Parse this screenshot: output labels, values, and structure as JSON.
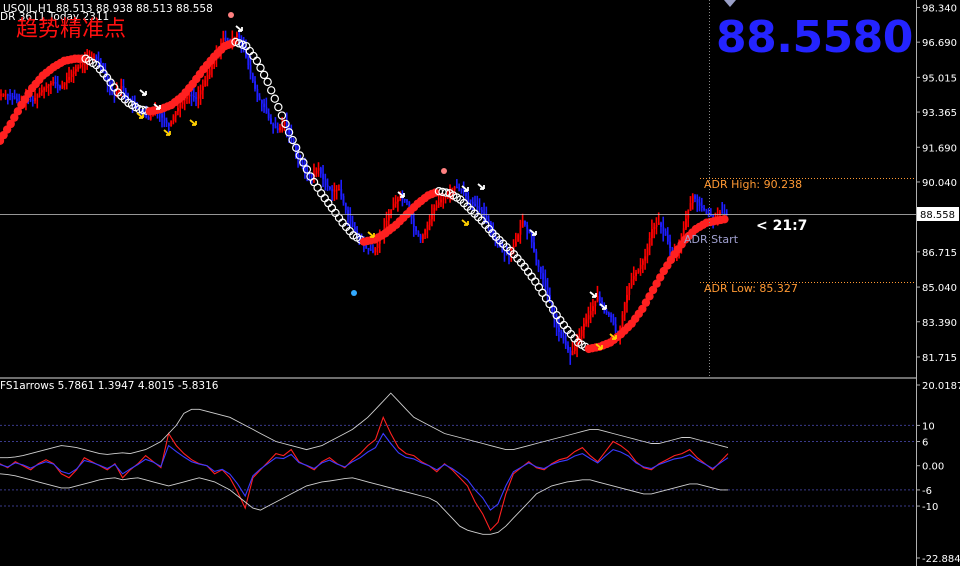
{
  "header": {
    "symbol_line": "USOIL,H1  88.513 88.938 88.513 88.558",
    "adr_line": "DR 3611  Today 2311",
    "chinese_title": "趋势精准点"
  },
  "big_price": "88.5580",
  "current_price_label": "88.558",
  "timer_text": "< 21:7",
  "adr": {
    "high_label": "ADR High: 90.238",
    "low_label": "ADR Low: 85.327",
    "start_label": "ADR Start"
  },
  "indicator": {
    "title": "FS1arrows 5.7861 1.3947 4.8015 -5.8316"
  },
  "colors": {
    "background": "#000000",
    "bull": "#ff0000",
    "bear": "#1e1eff",
    "trend_up": "#ff2020",
    "trend_down": "#ffffff",
    "big_price": "#2424ff",
    "adr": "#ff9933",
    "axis_text": "#ffffff",
    "grid": "#3a3a8a"
  },
  "chart_data": [
    {
      "type": "line",
      "title": "USOIL,H1",
      "y_ticks": [
        "98.340",
        "96.690",
        "95.015",
        "93.365",
        "91.690",
        "90.040",
        "88.558",
        "86.715",
        "85.040",
        "83.390",
        "81.715"
      ],
      "ylim": [
        81.0,
        98.6
      ],
      "series": [
        {
          "name": "price",
          "values": [
            94.2,
            94.1,
            93.8,
            94.0,
            93.9,
            94.3,
            94.6,
            94.8,
            94.5,
            94.9,
            95.3,
            95.6,
            95.9,
            96.0,
            95.7,
            94.8,
            94.2,
            94.6,
            94.0,
            93.6,
            93.4,
            93.0,
            93.6,
            93.1,
            92.7,
            93.4,
            93.9,
            94.2,
            94.0,
            94.6,
            95.4,
            96.1,
            96.9,
            96.6,
            97.1,
            96.4,
            95.2,
            94.1,
            93.6,
            92.8,
            92.5,
            92.9,
            92.1,
            91.2,
            90.5,
            90.3,
            90.7,
            89.9,
            89.6,
            89.7,
            88.7,
            87.9,
            87.3,
            86.9,
            86.7,
            87.3,
            88.2,
            89.0,
            89.3,
            89.1,
            87.9,
            87.3,
            88.0,
            88.8,
            89.2,
            89.4,
            89.8,
            89.7,
            89.2,
            88.9,
            88.6,
            88.1,
            87.3,
            86.8,
            86.6,
            87.2,
            88.2,
            87.6,
            86.3,
            85.4,
            84.3,
            83.1,
            82.5,
            81.8,
            82.4,
            83.3,
            83.9,
            84.6,
            83.9,
            83.6,
            82.6,
            84.3,
            85.4,
            85.9,
            86.5,
            87.8,
            88.1,
            87.5,
            86.6,
            86.9,
            88.3,
            89.4,
            88.9,
            88.6,
            88.3,
            88.6,
            88.5
          ]
        },
        {
          "name": "trend",
          "values": [
            92.0,
            92.8,
            93.7,
            94.5,
            95.1,
            95.5,
            95.8,
            95.9,
            95.9,
            95.6,
            95.0,
            94.3,
            93.8,
            93.5,
            93.4,
            93.5,
            93.7,
            94.1,
            94.7,
            95.4,
            96.0,
            96.5,
            96.7,
            96.5,
            95.8,
            94.8,
            93.6,
            92.4,
            91.3,
            90.3,
            89.5,
            88.8,
            88.1,
            87.5,
            87.2,
            87.3,
            87.6,
            88.0,
            88.5,
            89.0,
            89.4,
            89.6,
            89.5,
            89.2,
            88.7,
            88.2,
            87.6,
            87.1,
            86.6,
            86.0,
            85.3,
            84.5,
            83.7,
            83.0,
            82.4,
            82.1,
            82.2,
            82.4,
            82.8,
            83.3,
            84.0,
            84.9,
            85.8,
            86.6,
            87.3,
            87.8,
            88.1,
            88.2,
            88.3
          ]
        }
      ],
      "horizontal_lines": [
        {
          "name": "ADR High",
          "value": 90.238
        },
        {
          "name": "Current",
          "value": 88.558
        },
        {
          "name": "ADR Low",
          "value": 85.327
        }
      ]
    },
    {
      "type": "line",
      "title": "FS1arrows",
      "y_ticks": [
        "20.0187",
        "10",
        "6",
        "0.00",
        "-6",
        "-10",
        "-22.8843"
      ],
      "ylim": [
        -22.8843,
        20.0187
      ],
      "levels": [
        10,
        6,
        -6,
        -10
      ],
      "series": [
        {
          "name": "red",
          "values": [
            0.5,
            -0.5,
            1.0,
            0.0,
            -1.0,
            0.5,
            1.5,
            0.5,
            -2.0,
            -3.0,
            -1.0,
            2.0,
            1.0,
            0.0,
            -1.0,
            0.5,
            -3.0,
            -1.0,
            0.5,
            2.5,
            1.0,
            -0.5,
            8.0,
            5.0,
            3.0,
            1.5,
            0.5,
            0.0,
            -2.0,
            -1.0,
            -3.0,
            -6.5,
            -10.5,
            -3.0,
            -1.0,
            1.0,
            3.0,
            2.5,
            4.0,
            1.0,
            0.0,
            -1.0,
            1.0,
            2.0,
            0.5,
            -0.5,
            1.5,
            3.0,
            5.0,
            6.5,
            12.0,
            8.0,
            4.5,
            3.0,
            2.5,
            1.0,
            0.0,
            -1.5,
            0.5,
            -1.0,
            -3.0,
            -5.0,
            -9.0,
            -12.0,
            -16.0,
            -14.0,
            -7.0,
            -2.0,
            -0.5,
            1.0,
            -0.5,
            -1.0,
            0.5,
            1.5,
            2.0,
            3.5,
            4.5,
            2.5,
            1.0,
            3.5,
            6.0,
            5.0,
            3.5,
            1.0,
            -0.5,
            -1.0,
            0.5,
            1.5,
            2.5,
            3.0,
            4.0,
            2.0,
            0.5,
            -1.0,
            1.0,
            3.0
          ]
        },
        {
          "name": "blue",
          "values": [
            0.3,
            -0.3,
            0.7,
            0.2,
            -0.6,
            0.3,
            1.0,
            0.4,
            -1.4,
            -2.0,
            -0.8,
            1.3,
            0.8,
            0.1,
            -0.7,
            0.3,
            -2.0,
            -0.8,
            0.3,
            1.6,
            0.9,
            -0.2,
            5.0,
            3.5,
            2.2,
            1.0,
            0.4,
            0.0,
            -1.4,
            -0.9,
            -2.1,
            -4.5,
            -7.5,
            -2.5,
            -0.8,
            0.6,
            2.0,
            1.8,
            2.8,
            0.8,
            0.1,
            -0.7,
            0.7,
            1.4,
            0.4,
            -0.3,
            1.0,
            2.0,
            3.4,
            4.5,
            8.0,
            5.5,
            3.2,
            2.1,
            1.7,
            0.7,
            0.0,
            -1.0,
            0.3,
            -0.7,
            -2.0,
            -3.5,
            -6.0,
            -8.0,
            -11.0,
            -9.5,
            -5.0,
            -1.5,
            -0.4,
            0.7,
            -0.3,
            -0.7,
            0.3,
            1.0,
            1.4,
            2.4,
            3.0,
            1.8,
            0.7,
            2.4,
            4.0,
            3.4,
            2.4,
            0.7,
            -0.3,
            -0.7,
            0.3,
            1.0,
            1.7,
            2.0,
            2.7,
            1.4,
            0.4,
            -0.7,
            0.7,
            2.0
          ]
        },
        {
          "name": "upper band",
          "values": [
            2.0,
            2.0,
            2.2,
            2.5,
            3.0,
            3.5,
            4.0,
            4.5,
            5.0,
            4.8,
            4.5,
            4.0,
            3.5,
            3.0,
            2.8,
            3.0,
            3.2,
            3.0,
            3.5,
            4.0,
            5.0,
            6.0,
            8.0,
            10.0,
            13.0,
            14.0,
            14.0,
            13.5,
            13.0,
            12.5,
            12.0,
            11.0,
            10.0,
            9.0,
            8.0,
            7.0,
            6.0,
            5.5,
            5.0,
            4.5,
            4.0,
            4.5,
            5.0,
            6.0,
            7.0,
            8.0,
            9.0,
            10.5,
            12.0,
            14.0,
            16.0,
            18.0,
            16.0,
            14.0,
            12.0,
            11.0,
            10.0,
            9.0,
            8.0,
            7.5,
            7.0,
            6.5,
            6.0,
            5.5,
            5.0,
            4.5,
            4.0,
            4.0,
            4.5,
            5.0,
            5.5,
            6.0,
            6.5,
            7.0,
            7.5,
            8.0,
            8.5,
            9.0,
            9.0,
            8.5,
            8.0,
            7.5,
            7.0,
            6.5,
            6.0,
            5.5,
            5.5,
            6.0,
            6.5,
            7.0,
            7.0,
            6.5,
            6.0,
            5.5,
            5.0,
            4.5
          ]
        },
        {
          "name": "lower band",
          "values": [
            -2.0,
            -2.2,
            -2.5,
            -3.0,
            -3.5,
            -4.0,
            -4.5,
            -5.0,
            -5.5,
            -5.5,
            -5.0,
            -4.5,
            -4.0,
            -3.5,
            -3.2,
            -3.0,
            -3.5,
            -3.2,
            -3.0,
            -3.5,
            -4.0,
            -4.5,
            -5.0,
            -4.5,
            -4.0,
            -3.5,
            -3.0,
            -3.5,
            -4.0,
            -5.0,
            -6.0,
            -7.5,
            -9.0,
            -10.5,
            -11.0,
            -10.0,
            -9.0,
            -8.0,
            -7.0,
            -6.0,
            -5.0,
            -4.5,
            -4.0,
            -3.8,
            -3.5,
            -3.2,
            -3.0,
            -3.5,
            -4.0,
            -4.5,
            -5.0,
            -5.5,
            -6.0,
            -6.5,
            -7.0,
            -7.5,
            -8.0,
            -9.0,
            -11.0,
            -13.0,
            -15.0,
            -16.0,
            -16.5,
            -17.0,
            -17.0,
            -16.5,
            -15.0,
            -13.0,
            -11.0,
            -9.0,
            -7.0,
            -6.0,
            -5.0,
            -4.5,
            -4.0,
            -3.8,
            -3.5,
            -3.5,
            -4.0,
            -4.5,
            -5.0,
            -5.5,
            -6.0,
            -6.5,
            -7.0,
            -7.0,
            -6.5,
            -6.0,
            -5.5,
            -5.0,
            -4.5,
            -4.5,
            -5.0,
            -5.5,
            -6.0,
            -6.0
          ]
        }
      ]
    }
  ]
}
